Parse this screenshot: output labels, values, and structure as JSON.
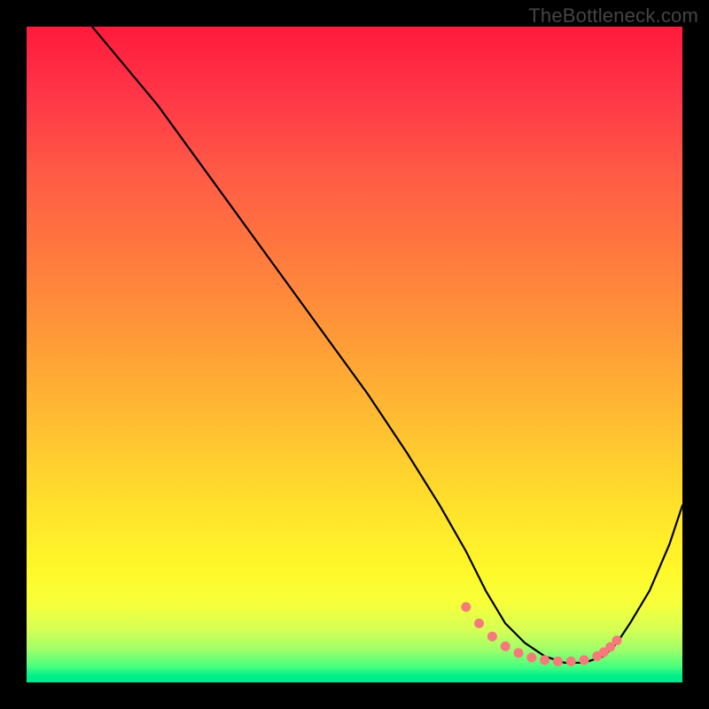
{
  "watermark": "TheBottleneck.com",
  "chart_data": {
    "type": "line",
    "title": "",
    "xlabel": "",
    "ylabel": "",
    "xlim": [
      0,
      100
    ],
    "ylim": [
      0,
      100
    ],
    "series": [
      {
        "name": "bottleneck-curve",
        "x": [
          10,
          15,
          20,
          28,
          36,
          44,
          52,
          58,
          63,
          67,
          70,
          73,
          76,
          79,
          82,
          85,
          88,
          90,
          92,
          95,
          98,
          100
        ],
        "values": [
          100,
          94,
          88,
          77,
          66,
          55,
          44,
          35,
          27,
          20,
          14,
          9,
          6,
          4,
          3,
          3,
          4,
          6,
          9,
          14,
          21,
          27
        ]
      }
    ],
    "markers": {
      "name": "highlight-dots",
      "color": "#f77a7a",
      "x": [
        67,
        69,
        71,
        73,
        75,
        77,
        79,
        81,
        83,
        85,
        87,
        88,
        89,
        90
      ],
      "values": [
        11.5,
        9,
        7,
        5.5,
        4.5,
        3.8,
        3.4,
        3.2,
        3.2,
        3.4,
        4,
        4.6,
        5.4,
        6.4
      ]
    },
    "background_gradient": {
      "direction": "vertical",
      "stops": [
        {
          "pos": 0,
          "color": "#ff1a3c"
        },
        {
          "pos": 50,
          "color": "#ff9938"
        },
        {
          "pos": 80,
          "color": "#fff82a"
        },
        {
          "pos": 100,
          "color": "#00e892"
        }
      ]
    }
  }
}
